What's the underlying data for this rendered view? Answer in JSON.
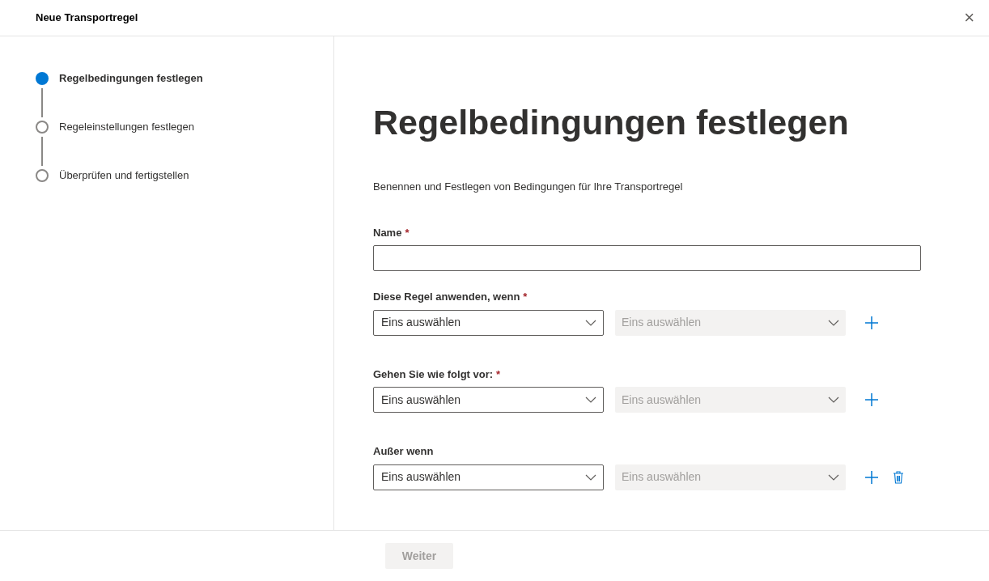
{
  "window": {
    "title": "Neue Transportregel",
    "close": "×"
  },
  "steps": [
    {
      "label": "Regelbedingungen festlegen",
      "selected": true
    },
    {
      "label": "Regeleinstellungen festlegen",
      "selected": false
    },
    {
      "label": "Überprüfen und fertigstellen",
      "selected": false
    }
  ],
  "heading": "Regelbedingungen festlegen",
  "description": "Benennen und Festlegen von Bedingungen für Ihre Transportregel",
  "name_field": {
    "label": "Name",
    "required_mark": "*"
  },
  "conditions": [
    {
      "label": "Diese Regel anwenden, wenn",
      "required_mark": "*",
      "first": {
        "text": "Eins auswählen",
        "disabled": false
      },
      "second": {
        "text": "Eins auswählen",
        "disabled": true
      },
      "deletable": false
    },
    {
      "label": "Gehen Sie wie folgt vor:",
      "required_mark": "*",
      "first": {
        "text": "Eins auswählen",
        "disabled": false
      },
      "second": {
        "text": "Eins auswählen",
        "disabled": true
      },
      "deletable": false
    },
    {
      "label": "Außer wenn",
      "first": {
        "text": "Eins auswählen",
        "disabled": false
      },
      "second": {
        "text": "Eins auswählen",
        "disabled": true
      },
      "deletable": true
    }
  ],
  "footer": {
    "button": {
      "label": "Weiter",
      "disabled": true
    }
  }
}
